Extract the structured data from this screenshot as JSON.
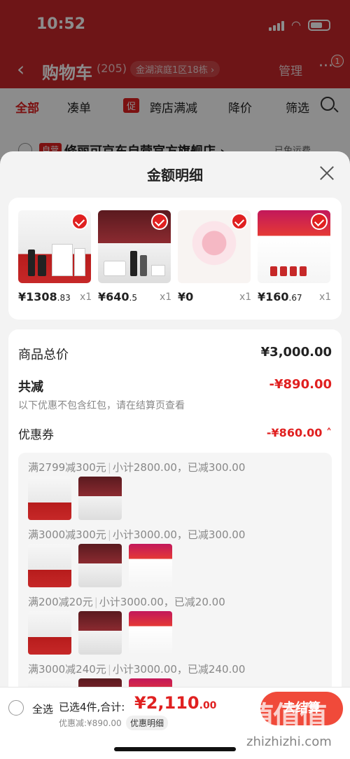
{
  "status_bar": {
    "time": "10:52"
  },
  "nav": {
    "back": "‹",
    "title": "购物车",
    "count": "(205)",
    "location": "金湖滨庭1区18栋 ›",
    "manage": "管理",
    "more": "···",
    "badge": "1"
  },
  "filters": {
    "all": "全部",
    "coudan": "凑单",
    "promo_tag": "促",
    "cross_store": "跨店满减",
    "price_drop": "降价",
    "filter": "筛选"
  },
  "store": {
    "tag": "自营",
    "name": "修丽可京东自营官方旗舰店 ›",
    "shipping": "已免运费"
  },
  "sheet": {
    "title": "金额明细",
    "products": [
      {
        "price_main": "¥1308",
        "price_dec": ".83",
        "qty": "x1",
        "art": "art-skin"
      },
      {
        "price_main": "¥640",
        "price_dec": ".5",
        "qty": "x1",
        "art": "art-skin2"
      },
      {
        "price_main": "¥0",
        "price_dec": "",
        "qty": "x1",
        "art": "art-bracelet"
      },
      {
        "price_main": "¥160",
        "price_dec": ".67",
        "qty": "x1",
        "art": "art-red"
      }
    ],
    "total_label": "商品总价",
    "total_value": "¥3,000.00",
    "discount_label": "共减",
    "discount_value": "-¥890.00",
    "note": "以下优惠不包含红包，请在结算页查看",
    "coupon_label": "优惠券",
    "coupon_value": "-¥860.00 ˄",
    "coupon_rules": [
      {
        "rule": "满2799减300元",
        "detail": "小计2800.00，已减300.00",
        "thumbs": [
          "art-skin",
          "art-skin2"
        ]
      },
      {
        "rule": "满3000减300元",
        "detail": "小计3000.00，已减300.00",
        "thumbs": [
          "art-skin",
          "art-skin2",
          "art-red"
        ]
      },
      {
        "rule": "满200减20元",
        "detail": "小计3000.00，已减20.00",
        "thumbs": [
          "art-skin",
          "art-skin2",
          "art-red"
        ]
      },
      {
        "rule": "满3000减240元",
        "detail": "小计3000.00，已减240.00",
        "thumbs": [
          "art-skin",
          "art-skin2",
          "art-red"
        ]
      }
    ]
  },
  "bottom": {
    "select_all": "全选",
    "selected": "已选4件,合计:",
    "total_main": "¥2,110",
    "total_dec": ".00",
    "saved": "优惠减:¥890.00",
    "detail_btn": "优惠明细",
    "checkout": "去结算",
    "watermark": "值值值",
    "watermark_url": "zhizhizhi.com"
  },
  "colors": {
    "accent": "#e02020",
    "nav_bg": "#c9272b",
    "checkout": "#f04a3a"
  }
}
